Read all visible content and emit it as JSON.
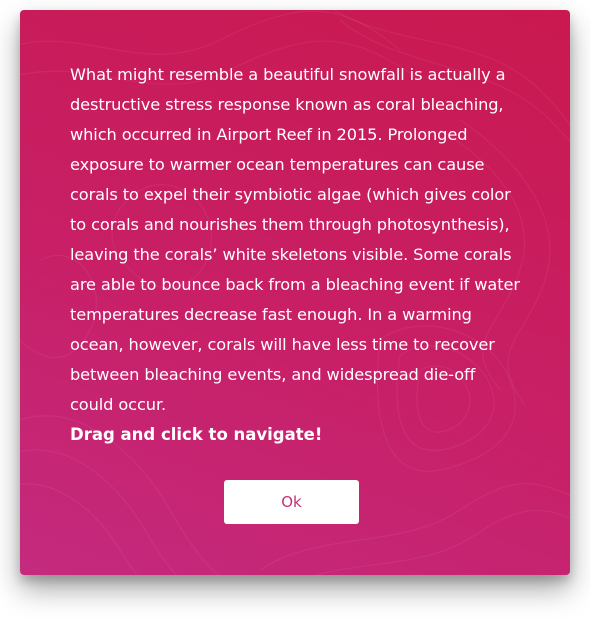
{
  "dialog": {
    "paragraph": "What might resemble a beautiful snowfall is actually a destructive stress response known as coral bleaching, which occurred in Airport Reef in 2015. Prolonged exposure to warmer ocean temperatures can cause corals to expel their symbiotic algae (which gives color to corals and nourishes them through photosynthesis), leaving the corals’ white skeletons visible. Some corals are able to bounce back from a bleaching event if water temperatures decrease fast enough. In a warming ocean, however, corals will have less time to recover between bleaching events, and widespread die-off could occur.",
    "navigation_hint": "Drag and click to navigate!",
    "ok_label": "Ok"
  },
  "colors": {
    "background_start": "#c42a7e",
    "background_end": "#c9194f",
    "text": "#ffffff",
    "button_background": "#ffffff",
    "button_text": "#c4307a"
  }
}
